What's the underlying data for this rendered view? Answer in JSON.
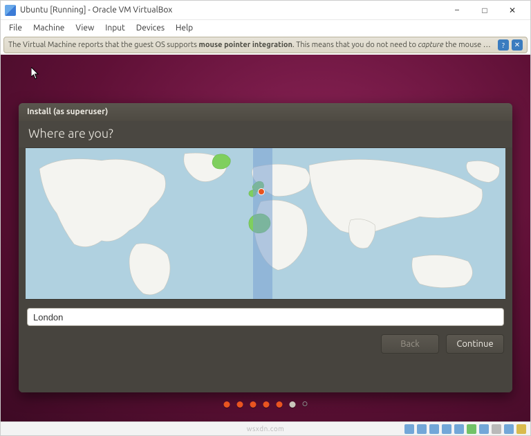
{
  "window": {
    "title": "Ubuntu [Running] - Oracle VM VirtualBox"
  },
  "menu": {
    "file": "File",
    "machine": "Machine",
    "view": "View",
    "input": "Input",
    "devices": "Devices",
    "help": "Help"
  },
  "infobar": {
    "prefix": "The Virtual Machine reports that the guest OS supports ",
    "bold": "mouse pointer integration",
    "middle": ". This means that you do not need to ",
    "italic": "capture",
    "suffix": " the mouse pointer to be able to use it in your guest OS -- all mouse"
  },
  "installer": {
    "titlebar": "Install (as superuser)",
    "heading": "Where are you?",
    "timezone_value": "London",
    "back": "Back",
    "continue": "Continue"
  },
  "statusbar": {
    "watermark": "wsxdn.com"
  }
}
